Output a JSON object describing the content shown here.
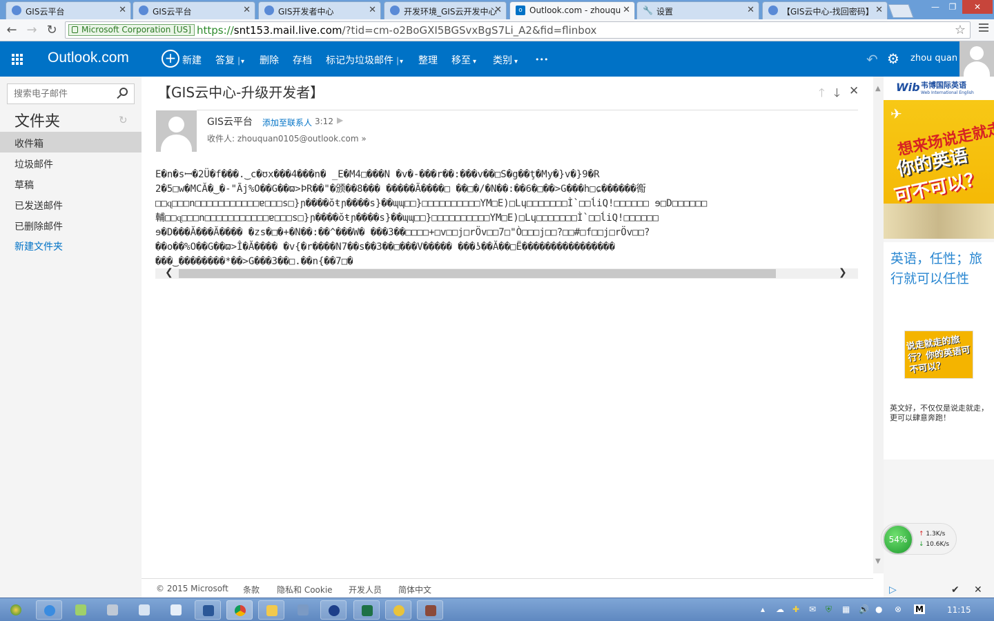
{
  "browser": {
    "tabs": [
      {
        "label": "GIS云平台",
        "active": false
      },
      {
        "label": "GIS云平台",
        "active": false
      },
      {
        "label": "GIS开发者中心",
        "active": false
      },
      {
        "label": "开发环境_GIS云开发中心",
        "active": false
      },
      {
        "label": "Outlook.com - zhouqu",
        "active": true
      },
      {
        "label": "设置",
        "active": false
      },
      {
        "label": "【GIS云中心-找回密码】",
        "active": false
      }
    ],
    "ev_cert": "Microsoft Corporation [US]",
    "url_scheme": "https://",
    "url_host": "snt153.mail.live.com",
    "url_path": "/?tid=cm-o2BoGXI5BGSvxBgS7Li_A2&fid=flinbox"
  },
  "app": {
    "brand": "Outlook.com",
    "toolbar": {
      "new": "新建",
      "reply": "答复",
      "delete": "删除",
      "archive": "存档",
      "junk": "标记为垃圾邮件",
      "sweep": "整理",
      "move": "移至",
      "category": "类别",
      "more": "•••"
    },
    "user_name": "zhou quan"
  },
  "sidebar": {
    "search_placeholder": "搜索电子邮件",
    "folders_title": "文件夹",
    "folders": [
      {
        "label": "收件箱",
        "selected": true
      },
      {
        "label": "垃圾邮件",
        "selected": false
      },
      {
        "label": "草稿",
        "selected": false
      },
      {
        "label": "已发送邮件",
        "selected": false
      },
      {
        "label": "已删除邮件",
        "selected": false
      }
    ],
    "new_folder": "新建文件夹"
  },
  "message": {
    "subject": "【GIS云中心-升级开发者】",
    "sender": "GIS云平台",
    "add_contact": "添加至联系人",
    "time": "3:12",
    "to_label": "收件人:",
    "to_address": "zhouquan0105@outlook.com",
    "body_lines": [
      "E�n�sꟷ�2Ü�f���.‿c�ʊx���4���n� _E�M4□���N �v�-���r��:���v��□S�g��ţ�My�}v�}9�R",
      "2�5□w�MCĂ�‿�-\"Ãj%O��G��ϖ>ÞR��\"�颁��8��� �����Ã����□ ��□�/�N��:��6�□��>G���h□ɕ������鵆",
      "□□ɋ□□□n□□□□□□□□□□□ɐ□□□s□}ɲ����ŏŧɲ����s}��ɰɰ□□}□□□□□□□□□□YM□E)□Lɥ□□□□□□□Ì`□□ĺiQ!□□□□□□ ɘ□D□□□□□□",
      "輔□□ɋ□□□n□□□□□□□□□□□ɐ□□□s□}ɲ����ŏŧɲ����s}��ɰɰ□□}□□□□□□□□□□YM□E)□Lɥ□□□□□□□Ì`□□ĺiQ!□□□□□□",
      "ɘ�D���Ă���Ă���� �zs�□�+�N��:��^���W� ���3��□□□□+□v□□j□rÖv□□7□\"Ò□□□j□□?□□#□f□□j□rÖv□□?",
      "��o��%O��G��ϖ>Î�Ă���� �v{�r����N7��s��3��□���V����� ���ʖ��Ă��□Ë����������������",
      "���‿��������*��>G���3��□.��n{��7□�"
    ]
  },
  "footer": {
    "copyright": "© 2015 Microsoft",
    "terms": "条款",
    "privacy": "隐私和 Cookie",
    "developers": "开发人员",
    "language": "简体中文"
  },
  "ad": {
    "logo_wib": "Wib",
    "logo_cn": "韦博国际英语",
    "logo_en": "Web International English",
    "banner_line1": "想来场说走就走的旅行？",
    "banner_line2": "你的英语",
    "banner_line3": "可不可以？",
    "headline": "英语，任性；旅行就可以任性",
    "thumb_text": "说走就走的旅行？你的英语可不可以？",
    "desc": "英文好，不仅仅是说走就走，更可以肆意奔跑！"
  },
  "netspeed": {
    "percent": "54%",
    "up": "1.3K/s",
    "down": "10.6K/s"
  },
  "taskbar": {
    "clock": "11:15"
  },
  "colors": {
    "outlook_blue": "#0072c6",
    "selected_folder": "#d4d4d4"
  }
}
